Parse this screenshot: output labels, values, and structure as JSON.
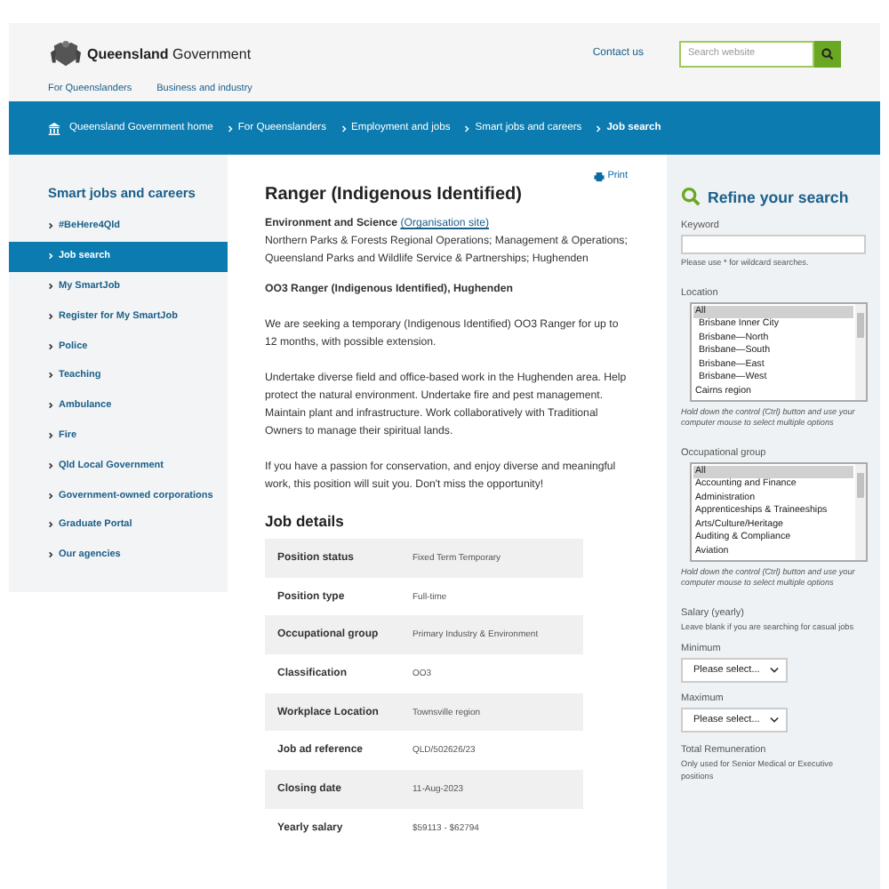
{
  "header": {
    "brand_bold": "Queensland",
    "brand_rest": "Government",
    "contact": "Contact us",
    "search": {
      "placeholder": "Search website"
    },
    "nav": [
      "For Queenslanders",
      "Business and industry"
    ]
  },
  "breadcrumbs": [
    {
      "label": "Queensland Government home",
      "current": false
    },
    {
      "label": "For Queenslanders",
      "current": false
    },
    {
      "label": "Employment and jobs",
      "current": false
    },
    {
      "label": "Smart jobs and careers",
      "current": false
    },
    {
      "label": "Job search",
      "current": true
    }
  ],
  "sidebar": {
    "title": "Smart jobs and careers",
    "items": [
      {
        "label": "#BeHere4Qld",
        "selected": false
      },
      {
        "label": "Job search",
        "selected": true
      },
      {
        "label": "My SmartJob",
        "selected": false
      },
      {
        "label": "Register for My SmartJob",
        "selected": false
      },
      {
        "label": "Police",
        "selected": false
      },
      {
        "label": "Teaching",
        "selected": false
      },
      {
        "label": "Ambulance",
        "selected": false
      },
      {
        "label": "Fire",
        "selected": false
      },
      {
        "label": "Qld Local Government",
        "selected": false
      },
      {
        "label": "Government-owned corporations",
        "selected": false
      },
      {
        "label": "Graduate Portal",
        "selected": false
      },
      {
        "label": "Our agencies",
        "selected": false
      }
    ]
  },
  "main": {
    "print": "Print",
    "title": "Ranger (Indigenous Identified)",
    "agency": "Environment and Science",
    "org_link": "(Organisation site)",
    "units": "Northern Parks & Forests Regional Operations; Management & Operations; Queensland Parks and Wildlife Service & Partnerships; Hughenden",
    "subtitle": "OO3 Ranger (Indigenous Identified), Hughenden",
    "paragraphs": [
      "We are seeking a temporary (Indigenous Identified) OO3 Ranger for up to 12 months, with possible extension.",
      "Undertake diverse field and office-based work in the Hughenden area. Help protect the natural environment. Undertake fire and pest management. Maintain plant and infrastructure. Work collaboratively with Traditional Owners to manage their spiritual lands.",
      "If you have a passion for conservation, and enjoy diverse and meaningful work, this position will suit you. Don't miss the opportunity!"
    ],
    "details_heading": "Job details",
    "details": [
      {
        "label": "Position status",
        "value": "Fixed Term Temporary"
      },
      {
        "label": "Position type",
        "value": "Full-time"
      },
      {
        "label": "Occupational group",
        "value": "Primary Industry & Environment"
      },
      {
        "label": "Classification",
        "value": "OO3"
      },
      {
        "label": "Workplace Location",
        "value": "Townsville region"
      },
      {
        "label": "Job ad reference",
        "value": "QLD/502626/23"
      },
      {
        "label": "Closing date",
        "value": "11-Aug-2023"
      },
      {
        "label": "Yearly salary",
        "value": "$59113 - $62794"
      }
    ]
  },
  "refine": {
    "title": "Refine your search",
    "keyword": {
      "label": "Keyword",
      "hint": "Please use * for wildcard searches."
    },
    "location": {
      "label": "Location",
      "options": [
        {
          "label": "All",
          "selected": true
        },
        {
          "label": "Brisbane Inner City",
          "selected": false
        },
        {
          "label": "Brisbane—North",
          "selected": false
        },
        {
          "label": "Brisbane—South",
          "selected": false
        },
        {
          "label": "Brisbane—East",
          "selected": false
        },
        {
          "label": "Brisbane—West",
          "selected": false
        },
        {
          "label": "Cairns region",
          "selected": false
        }
      ],
      "hint": "Hold down the control (Ctrl) button and use your computer mouse to select multiple options"
    },
    "occupational": {
      "label": "Occupational group",
      "options": [
        {
          "label": "All",
          "selected": true
        },
        {
          "label": "Accounting and Finance",
          "selected": false
        },
        {
          "label": "Administration",
          "selected": false
        },
        {
          "label": "Apprenticeships & Traineeships",
          "selected": false
        },
        {
          "label": "Arts/Culture/Heritage",
          "selected": false
        },
        {
          "label": "Auditing & Compliance",
          "selected": false
        },
        {
          "label": "Aviation",
          "selected": false
        }
      ],
      "hint": "Hold down the control (Ctrl) button and use your computer mouse to select multiple options"
    },
    "salary": {
      "label": "Salary (yearly)",
      "hint": "Leave blank if you are searching for casual jobs",
      "minimum": {
        "label": "Minimum",
        "value": "Please select..."
      },
      "maximum": {
        "label": "Maximum",
        "value": "Please select..."
      }
    },
    "remuneration": {
      "label": "Total Remuneration",
      "hint": "Only used for Senior Medical or Executive positions"
    }
  }
}
